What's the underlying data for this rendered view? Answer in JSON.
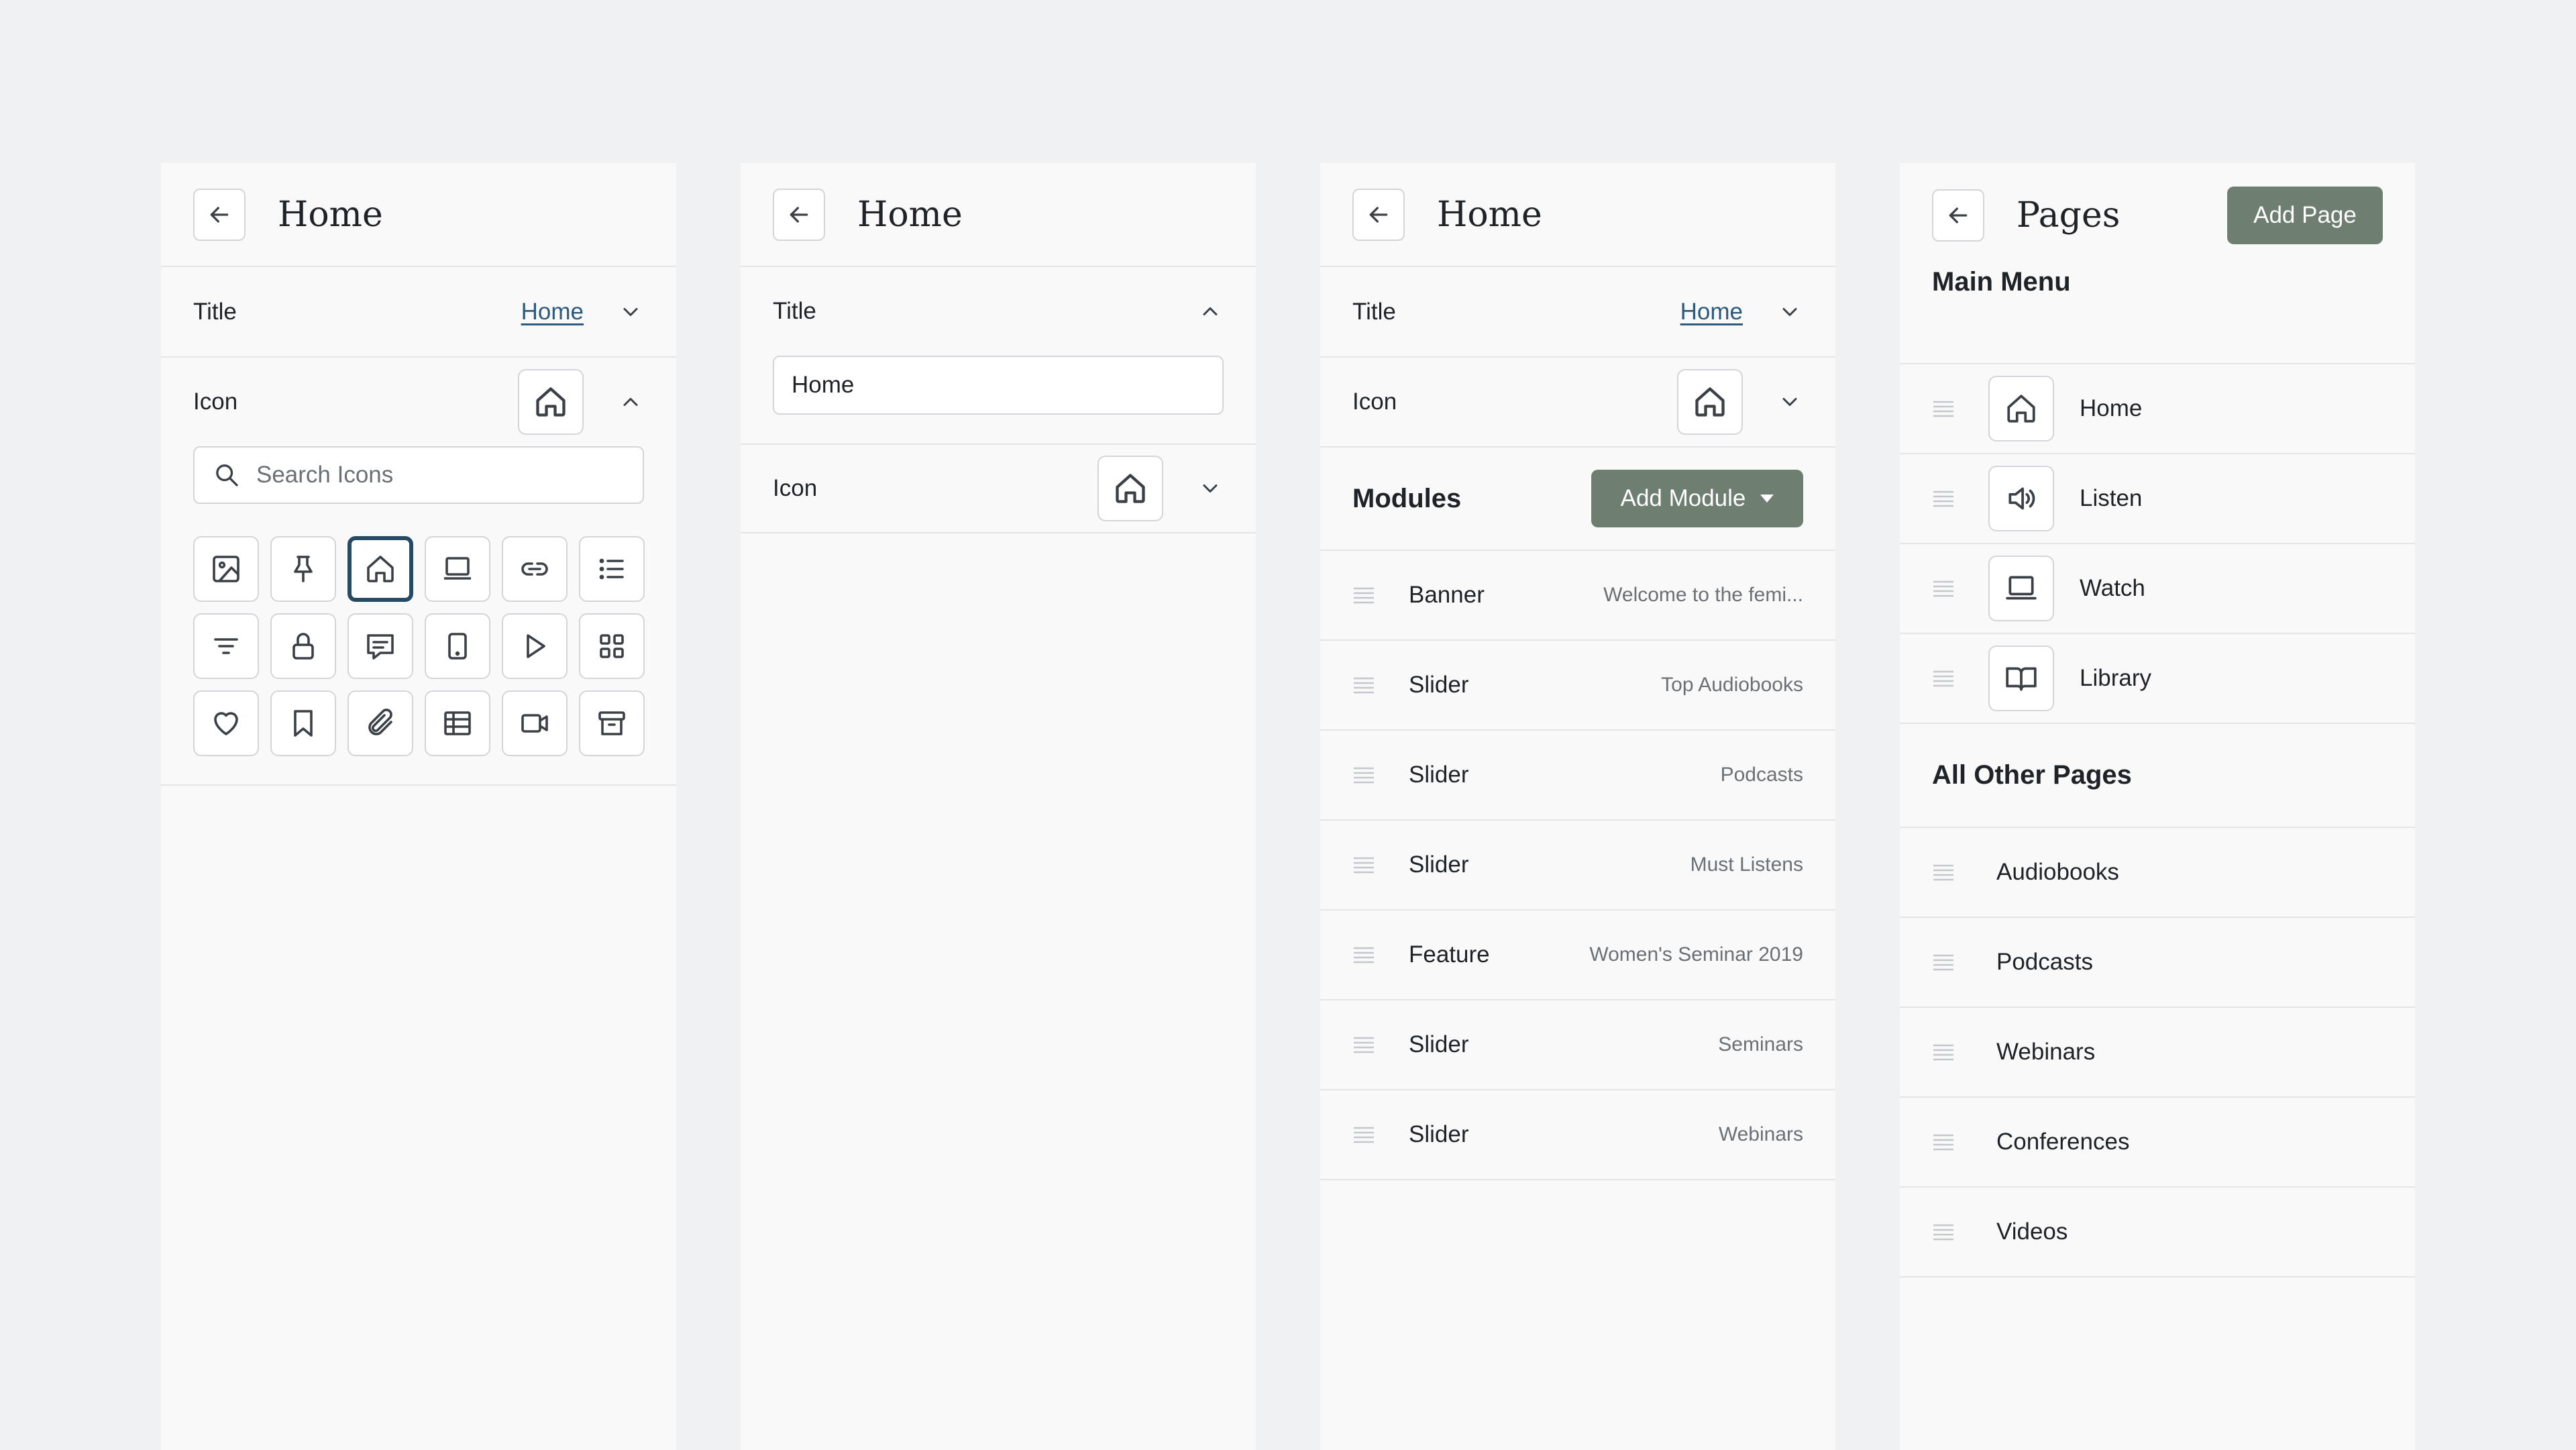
{
  "panel1": {
    "title": "Home",
    "title_row": {
      "label": "Title",
      "value": "Home"
    },
    "icon_row": {
      "label": "Icon"
    },
    "search": {
      "placeholder": "Search Icons"
    }
  },
  "panel2": {
    "title": "Home",
    "title_row": {
      "label": "Title",
      "input_value": "Home"
    },
    "icon_row": {
      "label": "Icon"
    }
  },
  "panel3": {
    "title": "Home",
    "title_row": {
      "label": "Title",
      "value": "Home"
    },
    "icon_row": {
      "label": "Icon"
    },
    "modules_label": "Modules",
    "add_module_label": "Add Module",
    "modules": [
      {
        "name": "Banner",
        "value": "Welcome to the femi..."
      },
      {
        "name": "Slider",
        "value": "Top Audiobooks"
      },
      {
        "name": "Slider",
        "value": "Podcasts"
      },
      {
        "name": "Slider",
        "value": "Must Listens"
      },
      {
        "name": "Feature",
        "value": "Women's Seminar 2019"
      },
      {
        "name": "Slider",
        "value": "Seminars"
      },
      {
        "name": "Slider",
        "value": "Webinars"
      }
    ]
  },
  "panel4": {
    "title": "Pages",
    "add_page_label": "Add Page",
    "main_menu_label": "Main Menu",
    "main_menu": [
      {
        "name": "Home",
        "icon": "home-icon"
      },
      {
        "name": "Listen",
        "icon": "speaker-icon"
      },
      {
        "name": "Watch",
        "icon": "laptop-icon"
      },
      {
        "name": "Library",
        "icon": "book-icon"
      }
    ],
    "other_pages_label": "All Other Pages",
    "other_pages": [
      "Audiobooks",
      "Podcasts",
      "Webinars",
      "Conferences",
      "Videos"
    ]
  },
  "colors": {
    "accent_green": "#6e7f72",
    "selected_border": "#244a64",
    "link": "#2d5a7c"
  }
}
